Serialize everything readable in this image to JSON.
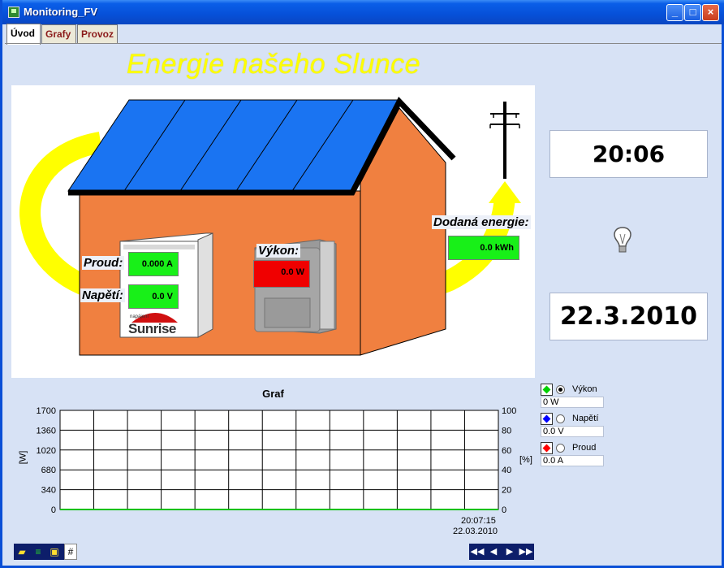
{
  "window": {
    "title": "Monitoring_FV"
  },
  "tabs": [
    {
      "label": "Úvod"
    },
    {
      "label": "Grafy"
    },
    {
      "label": "Provoz"
    }
  ],
  "banner": {
    "text": "Energie našeho Slunce"
  },
  "scene": {
    "proud": {
      "label": "Proud:",
      "value": "0.000 A"
    },
    "napeti": {
      "label": "Napětí:",
      "value": "0.0 V"
    },
    "vykon": {
      "label": "Výkon:",
      "value": "0.0 W"
    },
    "dodana": {
      "label": "Dodaná energie:",
      "value": "0.0 kWh"
    },
    "inverter_brand_small": "napájení",
    "inverter_brand": "Sunrise"
  },
  "side": {
    "time": "20:06",
    "date": "22.3.2010",
    "icon": "lightbulb-icon"
  },
  "chart": {
    "title": "Graf",
    "left_axis_label": "[W]",
    "right_axis_label": "[%]",
    "left_ticks": [
      "1700",
      "1360",
      "1020",
      "680",
      "340",
      "0"
    ],
    "right_ticks": [
      "100",
      "80",
      "60",
      "40",
      "20",
      "0"
    ],
    "time_label": "20:07:15",
    "date_label": "22.03.2010"
  },
  "chart_data": {
    "type": "line",
    "title": "Graf",
    "xlabel": "",
    "ylabel": "[W]",
    "ylim": [
      0,
      1700
    ],
    "y2label": "[%]",
    "y2lim": [
      0,
      100
    ],
    "grid": true,
    "series": [
      {
        "name": "Výkon",
        "color": "#00c000",
        "values": [
          0,
          0
        ]
      }
    ]
  },
  "legend": {
    "items": [
      {
        "label": "Výkon",
        "value": "0 W",
        "color": "#00d000",
        "selected": true
      },
      {
        "label": "Napětí",
        "value": "0.0 V",
        "color": "#0000ff",
        "selected": false
      },
      {
        "label": "Proud",
        "value": "0.0 A",
        "color": "#ff0000",
        "selected": false
      }
    ]
  },
  "colors": {
    "titlebar": "#0650d8",
    "background": "#d7e2f5",
    "banner": "#ffff00",
    "roof": "#1a74f2",
    "wall": "#f08040",
    "arrow": "#ffff00",
    "value_green": "#18f018",
    "value_red": "#f00000"
  }
}
